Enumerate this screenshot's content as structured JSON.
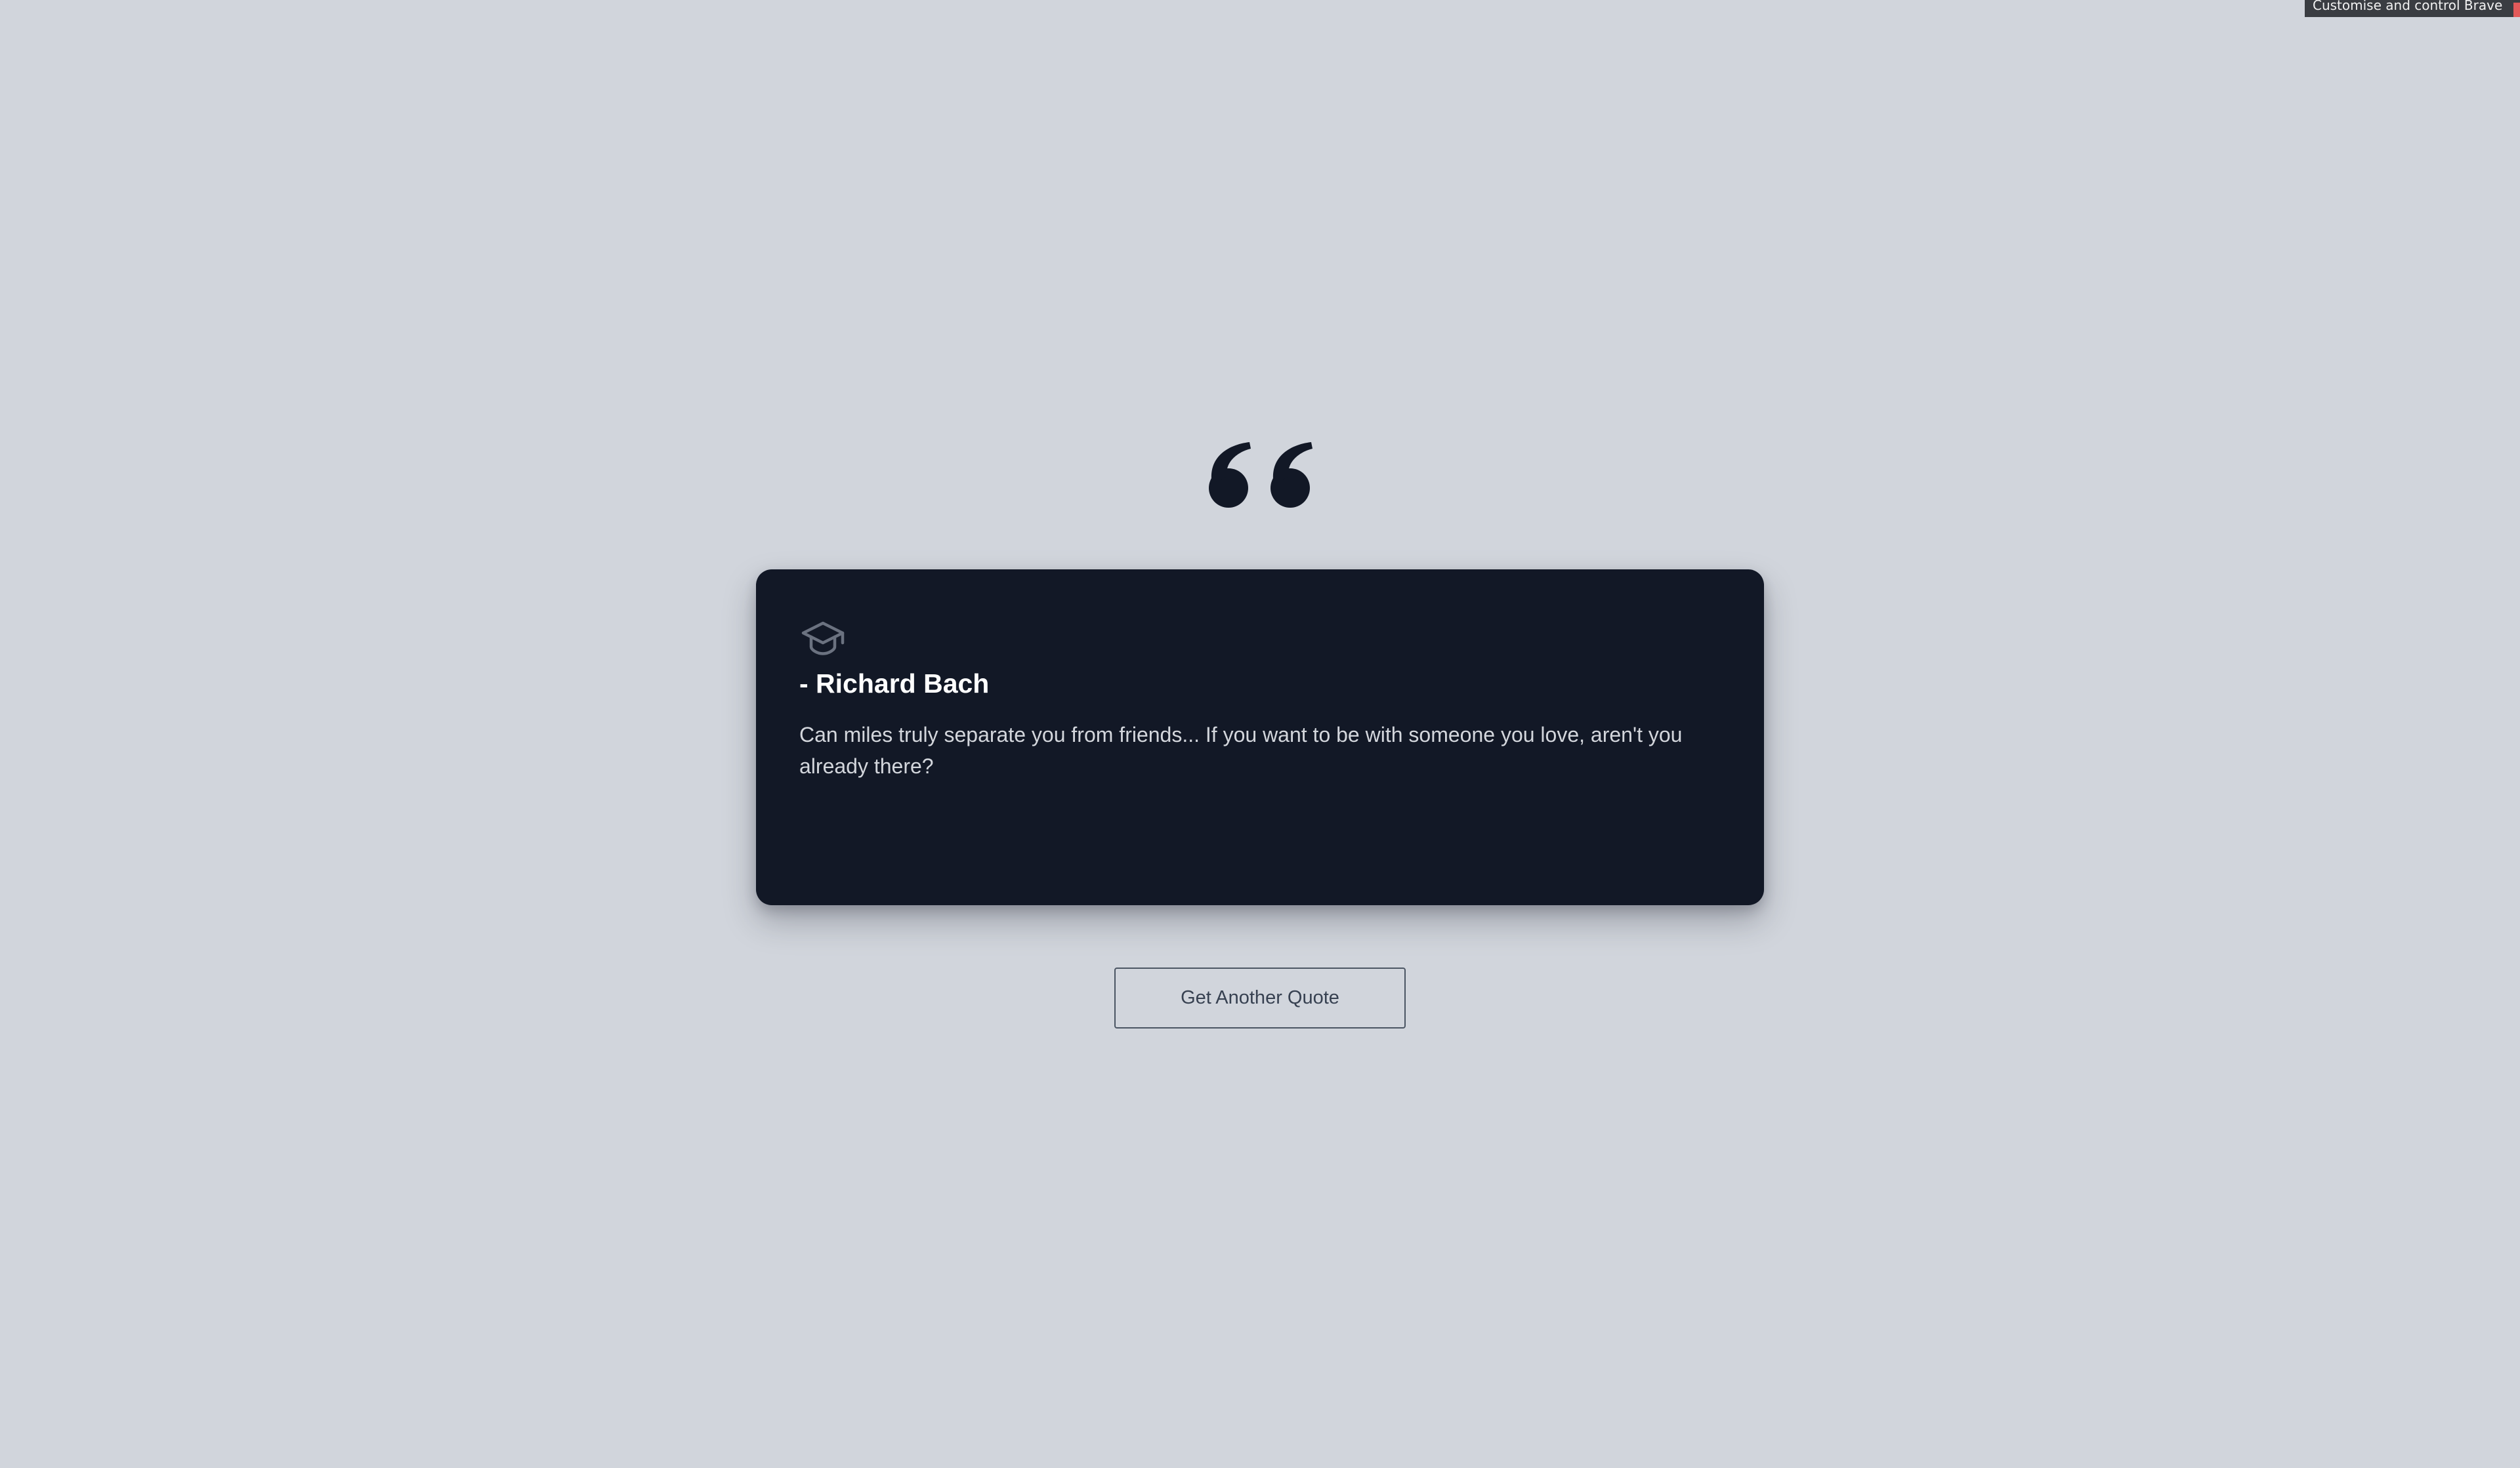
{
  "browser": {
    "tooltip": "Customise and control Brave"
  },
  "icons": {
    "quote_mark": "quote-open-icon",
    "category": "graduation-cap-icon"
  },
  "quote": {
    "author": "- Richard Bach",
    "text": "Can miles truly separate you from friends... If you want to be with someone you love, aren't you already there?"
  },
  "actions": {
    "next_label": "Get Another Quote"
  },
  "colors": {
    "background": "#d1d5dc",
    "card": "#121826",
    "quote_mark": "#121826",
    "icon": "#6b7280",
    "button_border": "#4b5563"
  }
}
